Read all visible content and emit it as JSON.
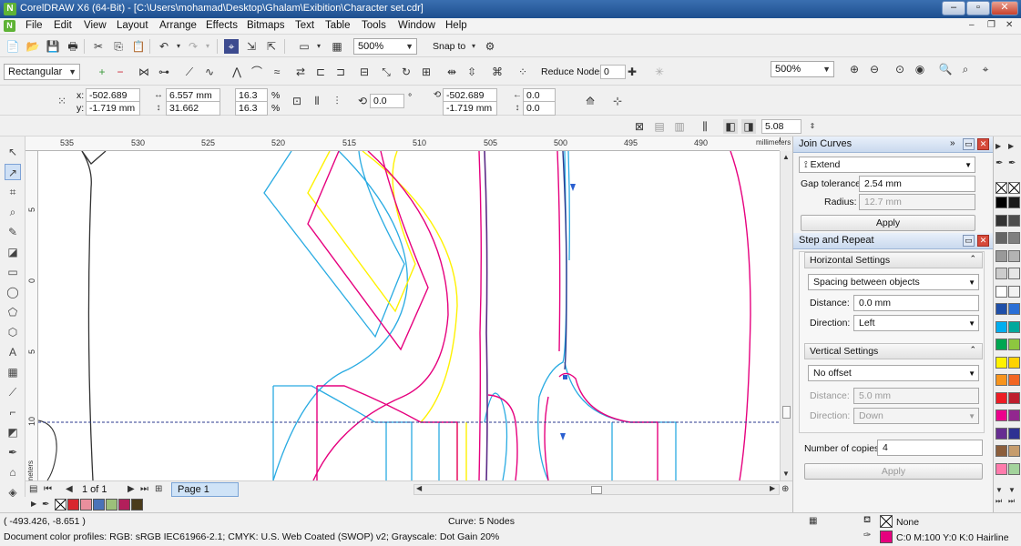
{
  "window": {
    "app_icon": "coreldraw-icon",
    "title": "CorelDRAW X6 (64-Bit) - [C:\\Users\\mohamad\\Desktop\\Ghalam\\Exibition\\Character set.cdr]",
    "minimize": "–",
    "restore": "▫",
    "close": "✕"
  },
  "menu": {
    "items": [
      {
        "label": "File",
        "accel": "F",
        "rest": "ile"
      },
      {
        "label": "Edit",
        "accel": "E",
        "rest": "dit"
      },
      {
        "label": "View",
        "accel": "V",
        "rest": "iew"
      },
      {
        "label": "Layout",
        "accel": "L",
        "rest": "ayout"
      },
      {
        "label": "Arrange",
        "accel": "A",
        "rest": "rrange"
      },
      {
        "label": "Effects",
        "accel": "C",
        "rest": "",
        "pre": "Effe",
        "post": "ts"
      },
      {
        "label": "Bitmaps",
        "accel": "B",
        "rest": "itmaps"
      },
      {
        "label": "Text",
        "accel": "x",
        "pre": "Te",
        "post": "t"
      },
      {
        "label": "Table",
        "accel": "T",
        "rest": "able"
      },
      {
        "label": "Tools",
        "accel": "o",
        "pre": "T",
        "post": "ols"
      },
      {
        "label": "Window",
        "accel": "W",
        "rest": "indow"
      },
      {
        "label": "Help",
        "accel": "H",
        "rest": "elp"
      }
    ]
  },
  "standard_toolbar": {
    "zoom_value": "500%",
    "snap_to_label": "Snap to"
  },
  "property_bar": {
    "mode_value": "Rectangular",
    "reduce_nodes_label": "Reduce Nodes",
    "reduce_nodes_value": "0",
    "zoom_value": "500%"
  },
  "transform_bar": {
    "x_label": "x:",
    "x_value": "-502.689 mm",
    "y_label": "y:",
    "y_value": "-1.719 mm",
    "width_value": "6.557 mm",
    "height_value": "31.662 mm",
    "scale_x": "16.3",
    "scale_y": "16.3",
    "percent": "%",
    "angle_value": "0.0",
    "degree": "°",
    "cx_value": "-502.689 mm",
    "cy_value": "-1.719 mm",
    "off_x": "0.0",
    "off_y": "0.0"
  },
  "outline_bar": {
    "width_value": "5.08 mm"
  },
  "ruler": {
    "units": "millimeters",
    "h_labels": [
      "535",
      "530",
      "525",
      "520",
      "515",
      "510",
      "505",
      "500",
      "495",
      "490"
    ],
    "v_labels": [
      "5",
      "0",
      "5",
      "10"
    ]
  },
  "page_nav": {
    "page_count": "1 of 1",
    "page_tab": "Page 1"
  },
  "docker": {
    "join_curves": {
      "title": "Join Curves",
      "mode": "Extend",
      "gap_label": "Gap tolerance:",
      "gap_value": "2.54 mm",
      "radius_label": "Radius:",
      "radius_value": "12.7 mm",
      "apply": "Apply"
    },
    "step_repeat": {
      "title": "Step and Repeat",
      "horizontal_head": "Horizontal Settings",
      "h_mode": "Spacing between objects",
      "distance_label": "Distance:",
      "h_distance": "0.0 mm",
      "direction_label": "Direction:",
      "h_direction": "Left",
      "vertical_head": "Vertical Settings",
      "v_mode": "No offset",
      "v_distance": "5.0 mm",
      "v_direction": "Down",
      "copies_label": "Number of copies:",
      "copies_value": "4",
      "apply": "Apply"
    }
  },
  "status": {
    "coords": "( -493.426, -8.651 )",
    "object_info": "Curve: 5 Nodes",
    "color_profiles": "Document color profiles: RGB: sRGB IEC61966-2.1; CMYK: U.S. Web Coated (SWOP) v2; Grayscale: Dot Gain 20%",
    "fill_label": "None",
    "outline_label": "C:0 M:100 Y:0 K:0  Hairline"
  },
  "bottom_palette": [
    "#d9262e",
    "#e98f9d",
    "#4a73b8",
    "#9cc07a",
    "#b21f5b",
    "#4a3b1a"
  ],
  "right_palette": [
    [
      "#000000",
      "#1a1a1a"
    ],
    [
      "#333333",
      "#4d4d4d"
    ],
    [
      "#666666",
      "#808080"
    ],
    [
      "#999999",
      "#b3b3b3"
    ],
    [
      "#cccccc",
      "#e6e6e6"
    ],
    [
      "#ffffff",
      "#f2f2f2"
    ],
    [
      "#1f4fa8",
      "#2a6fd6"
    ],
    [
      "#00aeef",
      "#00a99d"
    ],
    [
      "#00a651",
      "#8dc63f"
    ],
    [
      "#fff200",
      "#ffd200"
    ],
    [
      "#f7941d",
      "#f26522"
    ],
    [
      "#ed1c24",
      "#be1e2d"
    ],
    [
      "#ec008c",
      "#92278f"
    ],
    [
      "#662d91",
      "#2e3192"
    ],
    [
      "#8b5e3c",
      "#c69c6d"
    ],
    [
      "#ff7bac",
      "#a3d39c"
    ]
  ],
  "colors": {
    "cyan": "#29abe2",
    "magenta": "#e6007e",
    "yellow": "#fff200",
    "purple": "#5b2a86",
    "dark": "#333333",
    "guide": "#2b3a8f"
  }
}
